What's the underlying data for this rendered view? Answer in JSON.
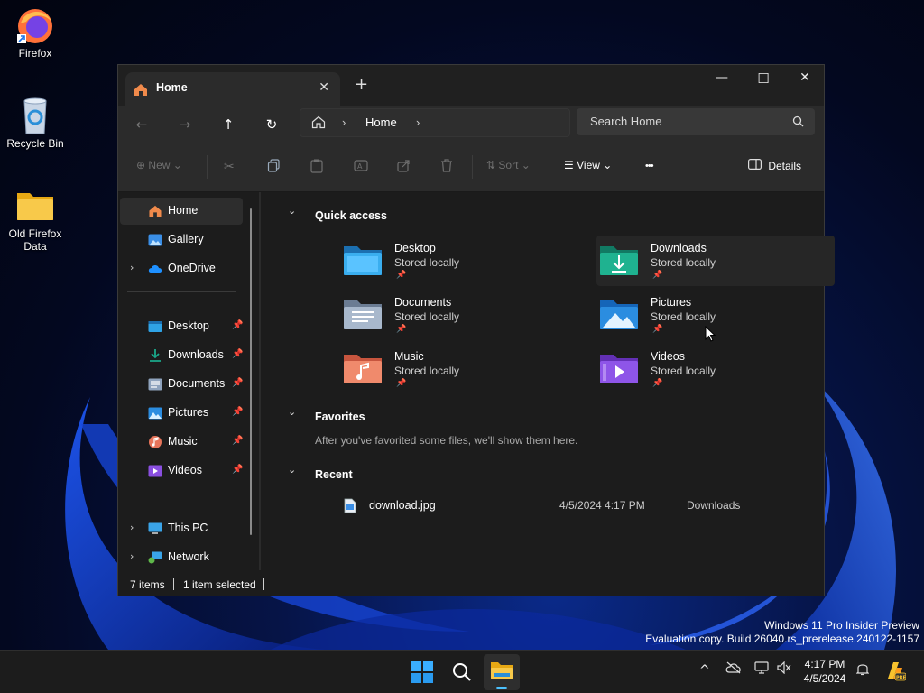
{
  "desktop": {
    "icons": [
      {
        "label": "Firefox"
      },
      {
        "label": "Recycle Bin"
      },
      {
        "label": "Old Firefox\nData"
      }
    ]
  },
  "window": {
    "tab_title": "Home",
    "tab_close": "✕",
    "new_tab": "+",
    "controls": {
      "minimize": "—",
      "maximize": "☐",
      "close": "✕"
    },
    "nav": {
      "back": "←",
      "forward": "→",
      "up": "↑",
      "refresh": "↻"
    },
    "address": {
      "crumbs": [
        "Home"
      ],
      "separator": "›"
    },
    "search": {
      "placeholder": "Search Home"
    },
    "toolbar": {
      "new_label": "New",
      "sort_label": "Sort",
      "view_label": "View",
      "more_label": "•••",
      "details_label": "Details"
    }
  },
  "sidebar": {
    "top_items": [
      {
        "label": "Home",
        "selected": true
      },
      {
        "label": "Gallery"
      },
      {
        "label": "OneDrive",
        "expandable": true
      }
    ],
    "pinned_items": [
      {
        "label": "Desktop"
      },
      {
        "label": "Downloads"
      },
      {
        "label": "Documents"
      },
      {
        "label": "Pictures"
      },
      {
        "label": "Music"
      },
      {
        "label": "Videos"
      }
    ],
    "bottom_items": [
      {
        "label": "This PC",
        "expandable": true
      },
      {
        "label": "Network",
        "expandable": true
      }
    ],
    "pin_glyph": "📌",
    "chevron": "›"
  },
  "content": {
    "quick_access": {
      "title": "Quick access",
      "items": [
        {
          "name": "Desktop",
          "sub": "Stored locally"
        },
        {
          "name": "Downloads",
          "sub": "Stored locally"
        },
        {
          "name": "Documents",
          "sub": "Stored locally"
        },
        {
          "name": "Pictures",
          "sub": "Stored locally"
        },
        {
          "name": "Music",
          "sub": "Stored locally"
        },
        {
          "name": "Videos",
          "sub": "Stored locally"
        }
      ]
    },
    "favorites": {
      "title": "Favorites",
      "empty_text": "After you've favorited some files, we'll show them here."
    },
    "recent": {
      "title": "Recent",
      "rows": [
        {
          "name": "download.jpg",
          "date": "4/5/2024 4:17 PM",
          "location": "Downloads"
        }
      ]
    },
    "chevron_down": "⌄"
  },
  "status": {
    "items_count": "7 items",
    "selected": "1 item selected"
  },
  "watermark": {
    "line1": "Windows 11 Pro Insider Preview",
    "line2": "Evaluation copy. Build 26040.rs_prerelease.240122-1157"
  },
  "taskbar": {
    "time": "4:17 PM",
    "date": "4/5/2024",
    "tray_chevron": "^"
  },
  "colors": {
    "accent": "#4cc2ff",
    "folder_yellow": "#f4c542",
    "downloads_teal": "#1aa88a"
  }
}
